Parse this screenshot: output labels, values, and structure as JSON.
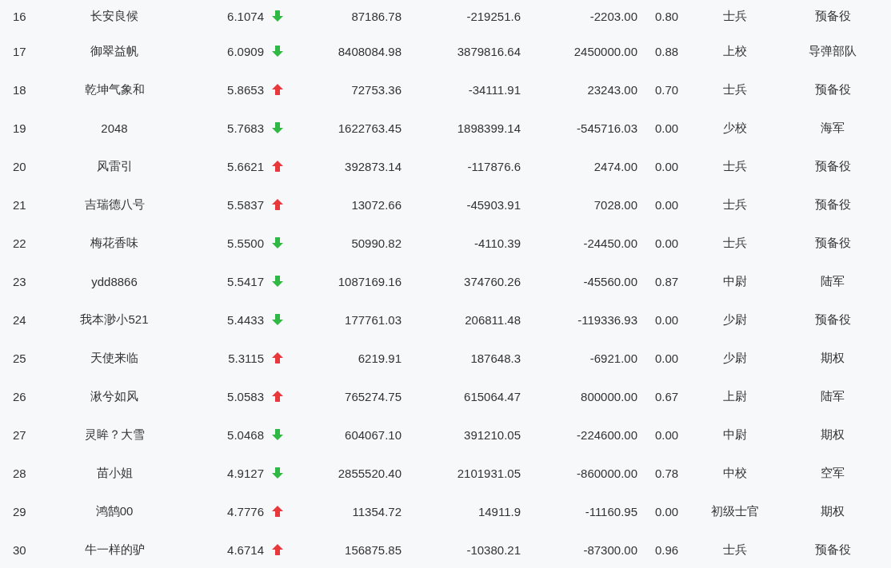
{
  "rows": [
    {
      "rank": "16",
      "name": "长安良候",
      "value": "6.1074",
      "kind": "down",
      "col_4": "87186.78",
      "col_5": "-219251.6",
      "col_6": "-2203.00",
      "col_7": "0.80",
      "col_8": "士兵",
      "col_9": "预备役"
    },
    {
      "rank": "17",
      "name": "御翠益帆",
      "value": "6.0909",
      "kind": "down",
      "col_4": "8408084.98",
      "col_5": "3879816.64",
      "col_6": "2450000.00",
      "col_7": "0.88",
      "col_8": "上校",
      "col_9": "导弹部队"
    },
    {
      "rank": "18",
      "name": "乾坤气象和",
      "value": "5.8653",
      "kind": "up",
      "col_4": "72753.36",
      "col_5": "-34111.91",
      "col_6": "23243.00",
      "col_7": "0.70",
      "col_8": "士兵",
      "col_9": "预备役"
    },
    {
      "rank": "19",
      "name": "2048",
      "value": "5.7683",
      "kind": "down",
      "col_4": "1622763.45",
      "col_5": "1898399.14",
      "col_6": "-545716.03",
      "col_7": "0.00",
      "col_8": "少校",
      "col_9": "海军"
    },
    {
      "rank": "20",
      "name": "风雷引",
      "value": "5.6621",
      "kind": "up",
      "col_4": "392873.14",
      "col_5": "-117876.6",
      "col_6": "2474.00",
      "col_7": "0.00",
      "col_8": "士兵",
      "col_9": "预备役"
    },
    {
      "rank": "21",
      "name": "吉瑞德八号",
      "value": "5.5837",
      "kind": "up",
      "col_4": "13072.66",
      "col_5": "-45903.91",
      "col_6": "7028.00",
      "col_7": "0.00",
      "col_8": "士兵",
      "col_9": "预备役"
    },
    {
      "rank": "22",
      "name": "梅花香味",
      "value": "5.5500",
      "kind": "down",
      "col_4": "50990.82",
      "col_5": "-4110.39",
      "col_6": "-24450.00",
      "col_7": "0.00",
      "col_8": "士兵",
      "col_9": "预备役"
    },
    {
      "rank": "23",
      "name": "ydd8866",
      "value": "5.5417",
      "kind": "down",
      "col_4": "1087169.16",
      "col_5": "374760.26",
      "col_6": "-45560.00",
      "col_7": "0.87",
      "col_8": "中尉",
      "col_9": "陆军"
    },
    {
      "rank": "24",
      "name": "我本渺小521",
      "value": "5.4433",
      "kind": "down",
      "col_4": "177761.03",
      "col_5": "206811.48",
      "col_6": "-119336.93",
      "col_7": "0.00",
      "col_8": "少尉",
      "col_9": "预备役"
    },
    {
      "rank": "25",
      "name": "天使来临",
      "value": "5.3115",
      "kind": "up",
      "col_4": "6219.91",
      "col_5": "187648.3",
      "col_6": "-6921.00",
      "col_7": "0.00",
      "col_8": "少尉",
      "col_9": "期权"
    },
    {
      "rank": "26",
      "name": "湫兮如风",
      "value": "5.0583",
      "kind": "up",
      "col_4": "765274.75",
      "col_5": "615064.47",
      "col_6": "800000.00",
      "col_7": "0.67",
      "col_8": "上尉",
      "col_9": "陆军"
    },
    {
      "rank": "27",
      "name": "灵眸？大雪",
      "value": "5.0468",
      "kind": "down",
      "col_4": "604067.10",
      "col_5": "391210.05",
      "col_6": "-224600.00",
      "col_7": "0.00",
      "col_8": "中尉",
      "col_9": "期权"
    },
    {
      "rank": "28",
      "name": "苗小姐",
      "value": "4.9127",
      "kind": "down",
      "col_4": "2855520.40",
      "col_5": "2101931.05",
      "col_6": "-860000.00",
      "col_7": "0.78",
      "col_8": "中校",
      "col_9": "空军"
    },
    {
      "rank": "29",
      "name": "鸿鹄00",
      "value": "4.7776",
      "kind": "up",
      "col_4": "11354.72",
      "col_5": "14911.9",
      "col_6": "-11160.95",
      "col_7": "0.00",
      "col_8": "初级士官",
      "col_9": "期权"
    },
    {
      "rank": "30",
      "name": "牛一样的驴",
      "value": "4.6714",
      "kind": "up",
      "col_4": "156875.85",
      "col_5": "-10380.21",
      "col_6": "-87300.00",
      "col_7": "0.96",
      "col_8": "士兵",
      "col_9": "预备役"
    }
  ]
}
